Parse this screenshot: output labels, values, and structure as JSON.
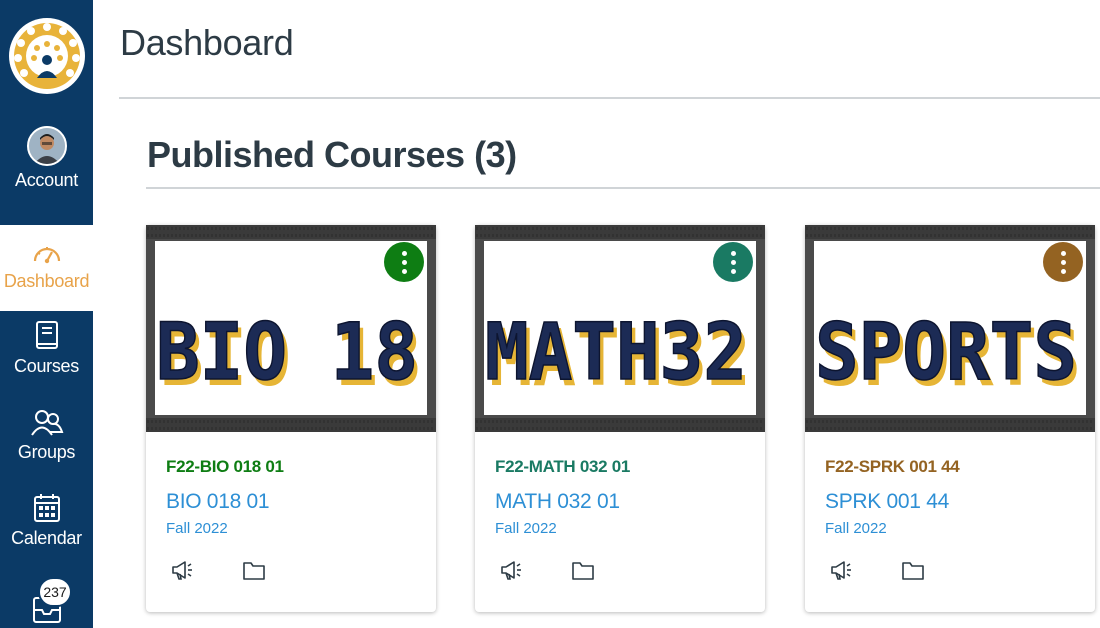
{
  "nav": {
    "items": [
      {
        "label": "Account",
        "icon": "avatar"
      },
      {
        "label": "Dashboard",
        "icon": "dashboard-icon"
      },
      {
        "label": "Courses",
        "icon": "book-icon"
      },
      {
        "label": "Groups",
        "icon": "groups-icon"
      },
      {
        "label": "Calendar",
        "icon": "calendar-icon"
      },
      {
        "label": "",
        "icon": "inbox-icon"
      }
    ],
    "inbox_badge": "237"
  },
  "page": {
    "title": "Dashboard",
    "section_title": "Published Courses (3)"
  },
  "cards": [
    {
      "image_text": "BIO 18",
      "code": "F22-BIO 018 01",
      "name": "BIO 018 01",
      "term": "Fall 2022",
      "color": "#0e7d13"
    },
    {
      "image_text": "MATH32",
      "code": "F22-MATH 032 01",
      "name": "MATH 032 01",
      "term": "Fall 2022",
      "color": "#1a7a63"
    },
    {
      "image_text": "SPORTS",
      "code": "F22-SPRK 001 44",
      "name": "SPRK 001 44",
      "term": "Fall 2022",
      "color": "#946322"
    }
  ],
  "colors": {
    "nav_bg": "#0b3a66",
    "active_accent": "#e8a34a",
    "link": "#2d8fd5",
    "letter_fill": "#1c2b55",
    "letter_shadow": "#e6b536"
  }
}
